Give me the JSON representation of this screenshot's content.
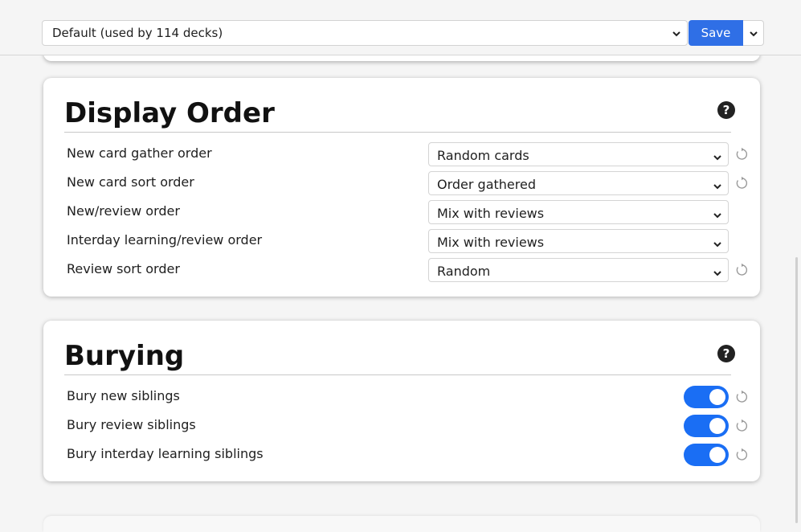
{
  "header": {
    "preset_label": "Default (used by 114 decks)",
    "save_label": "Save"
  },
  "display_order": {
    "title": "Display Order",
    "rows": [
      {
        "label": "New card gather order",
        "value": "Random cards",
        "has_revert": true
      },
      {
        "label": "New card sort order",
        "value": "Order gathered",
        "has_revert": true
      },
      {
        "label": "New/review order",
        "value": "Mix with reviews",
        "has_revert": false
      },
      {
        "label": "Interday learning/review order",
        "value": "Mix with reviews",
        "has_revert": false
      },
      {
        "label": "Review sort order",
        "value": "Random",
        "has_revert": true
      }
    ]
  },
  "burying": {
    "title": "Burying",
    "rows": [
      {
        "label": "Bury new siblings",
        "enabled": true
      },
      {
        "label": "Bury review siblings",
        "enabled": true
      },
      {
        "label": "Bury interday learning siblings",
        "enabled": true
      }
    ]
  },
  "colors": {
    "accent": "#2f6fe6",
    "toggle_on": "#1a6ef4"
  },
  "icons": {
    "help": "help-icon",
    "revert": "revert-icon",
    "chevron": "chevron-down-icon"
  }
}
